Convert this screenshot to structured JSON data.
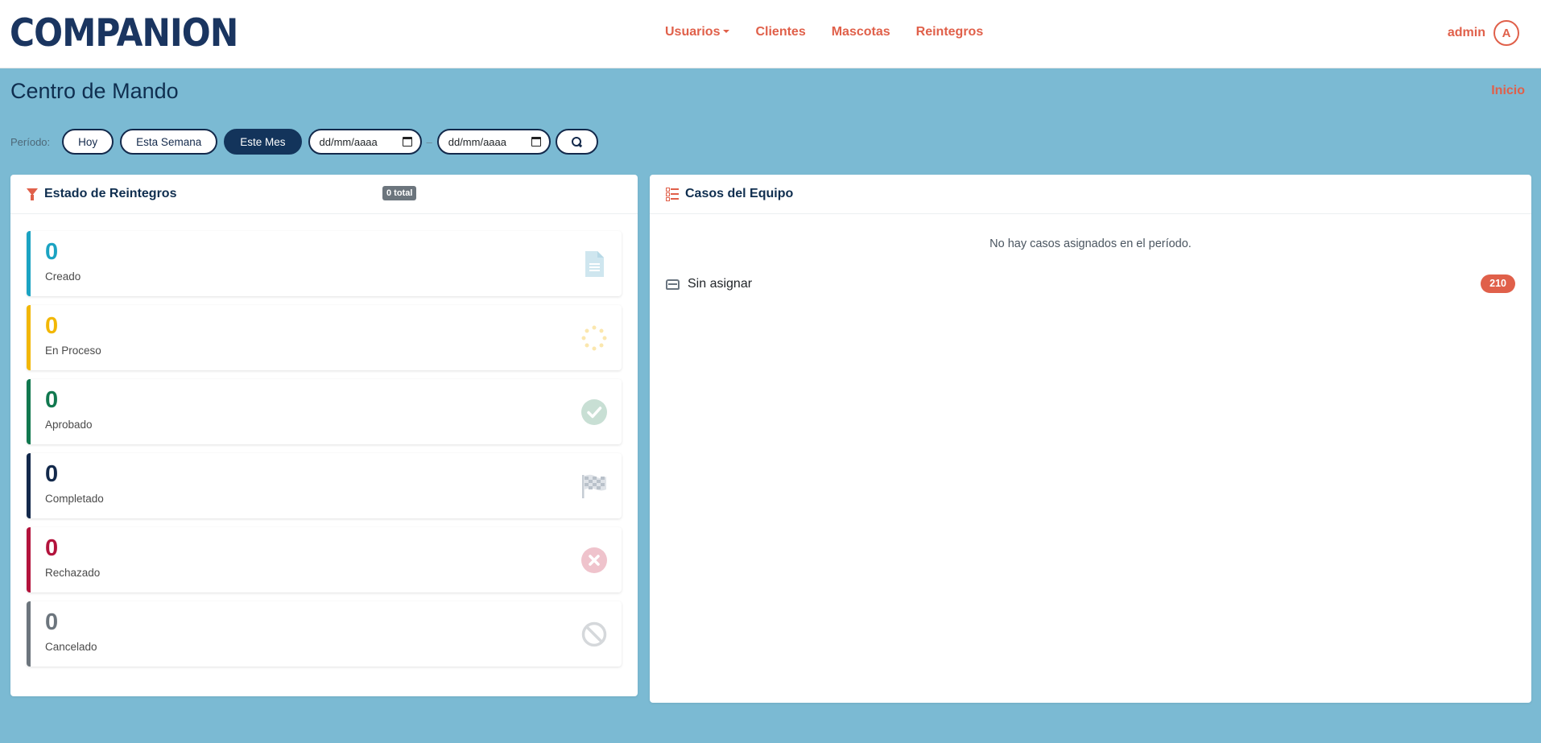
{
  "brand": "COMPANION",
  "nav": {
    "usuarios": "Usuarios",
    "clientes": "Clientes",
    "mascotas": "Mascotas",
    "reintegros": "Reintegros"
  },
  "user": {
    "name": "admin",
    "initial": "A"
  },
  "page": {
    "title": "Centro de Mando",
    "breadcrumb": "Inicio"
  },
  "filters": {
    "label": "Período:",
    "today": "Hoy",
    "week": "Esta Semana",
    "month": "Este Mes",
    "active": "Este Mes",
    "date_from": "dd/mm/aaaa",
    "date_to": "dd/mm/aaaa",
    "separator": "–"
  },
  "reintegros_card": {
    "title": "Estado de Reintegros",
    "total_badge": "0 total",
    "stats": [
      {
        "value": "0",
        "label": "Creado",
        "color": "#1ba3c2",
        "icon": "file-icon"
      },
      {
        "value": "0",
        "label": "En Proceso",
        "color": "#f2b705",
        "icon": "spinner-icon"
      },
      {
        "value": "0",
        "label": "Aprobado",
        "color": "#11784f",
        "icon": "check-circle-icon"
      },
      {
        "value": "0",
        "label": "Completado",
        "color": "#13294b",
        "icon": "checkered-flag-icon"
      },
      {
        "value": "0",
        "label": "Rechazado",
        "color": "#b3133c",
        "icon": "x-circle-icon"
      },
      {
        "value": "0",
        "label": "Cancelado",
        "color": "#6c757d",
        "icon": "ban-icon"
      }
    ]
  },
  "casos_card": {
    "title": "Casos del Equipo",
    "empty_message": "No hay casos asignados en el período.",
    "unassigned_label": "Sin asignar",
    "unassigned_count": "210"
  },
  "colors": {
    "accent": "#e0604a",
    "navy": "#13294b",
    "background": "#7bbad3"
  }
}
